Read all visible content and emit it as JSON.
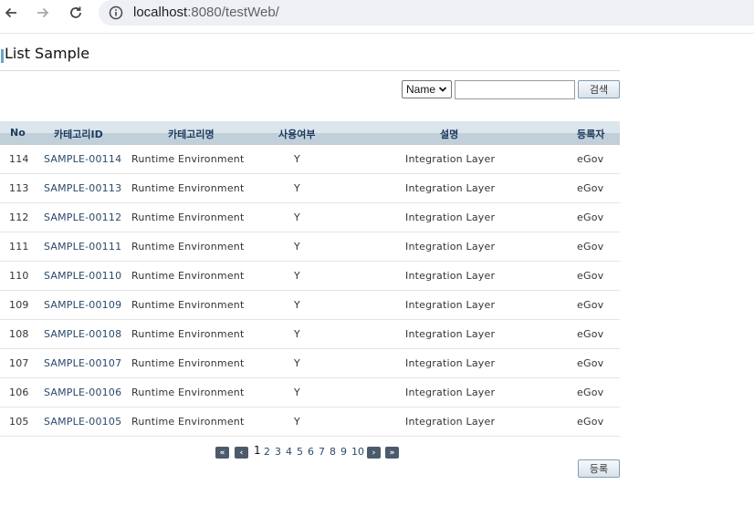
{
  "browser": {
    "url_host": "localhost",
    "url_rest": ":8080/testWeb/"
  },
  "page": {
    "title": "List Sample"
  },
  "search": {
    "select_value": "Name",
    "input_value": "",
    "button_label": "검색"
  },
  "table": {
    "headers": [
      "No",
      "카테고리ID",
      "카테고리명",
      "사용여부",
      "설명",
      "등록자"
    ],
    "rows": [
      [
        "114",
        "SAMPLE-00114",
        "Runtime Environment",
        "Y",
        "Integration Layer",
        "eGov"
      ],
      [
        "113",
        "SAMPLE-00113",
        "Runtime Environment",
        "Y",
        "Integration Layer",
        "eGov"
      ],
      [
        "112",
        "SAMPLE-00112",
        "Runtime Environment",
        "Y",
        "Integration Layer",
        "eGov"
      ],
      [
        "111",
        "SAMPLE-00111",
        "Runtime Environment",
        "Y",
        "Integration Layer",
        "eGov"
      ],
      [
        "110",
        "SAMPLE-00110",
        "Runtime Environment",
        "Y",
        "Integration Layer",
        "eGov"
      ],
      [
        "109",
        "SAMPLE-00109",
        "Runtime Environment",
        "Y",
        "Integration Layer",
        "eGov"
      ],
      [
        "108",
        "SAMPLE-00108",
        "Runtime Environment",
        "Y",
        "Integration Layer",
        "eGov"
      ],
      [
        "107",
        "SAMPLE-00107",
        "Runtime Environment",
        "Y",
        "Integration Layer",
        "eGov"
      ],
      [
        "106",
        "SAMPLE-00106",
        "Runtime Environment",
        "Y",
        "Integration Layer",
        "eGov"
      ],
      [
        "105",
        "SAMPLE-00105",
        "Runtime Environment",
        "Y",
        "Integration Layer",
        "eGov"
      ]
    ]
  },
  "pagination": {
    "first": "«",
    "prev": "‹",
    "pages": [
      "1",
      "2",
      "3",
      "4",
      "5",
      "6",
      "7",
      "8",
      "9",
      "10"
    ],
    "current": "1",
    "next": "›",
    "last": "»"
  },
  "actions": {
    "register_label": "등록"
  }
}
